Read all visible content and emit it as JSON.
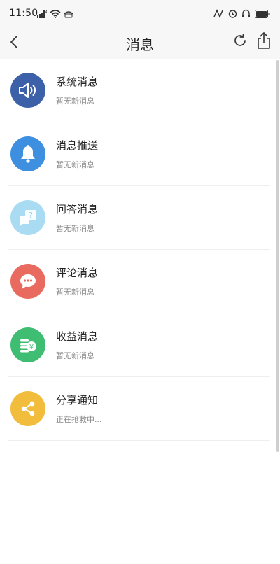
{
  "status_bar": {
    "time": "11:50"
  },
  "nav": {
    "title": "消息"
  },
  "items": [
    {
      "title": "系统消息",
      "subtitle": "暂无新消息",
      "color": "#3d61a8",
      "icon": "speaker-icon"
    },
    {
      "title": "消息推送",
      "subtitle": "暂无新消息",
      "color": "#3f8fe0",
      "icon": "bell-icon"
    },
    {
      "title": "问答消息",
      "subtitle": "暂无新消息",
      "color": "#a9dcf2",
      "icon": "question-bubble-icon"
    },
    {
      "title": "评论消息",
      "subtitle": "暂无新消息",
      "color": "#e96b5f",
      "icon": "comment-icon"
    },
    {
      "title": "收益消息",
      "subtitle": "暂无新消息",
      "color": "#3fbe73",
      "icon": "coins-icon"
    },
    {
      "title": "分享通知",
      "subtitle": "正在抢救中...",
      "color": "#f2bd3c",
      "icon": "share-icon"
    }
  ]
}
